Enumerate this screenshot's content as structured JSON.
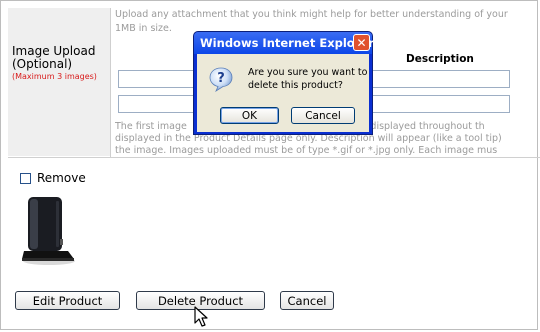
{
  "form": {
    "help_top_line1": "Upload any attachment that you think might help for better understanding of your",
    "help_top_line2": "1MB in size.",
    "label_line1": "Image Upload",
    "label_line2": "(Optional)",
    "label_note": "(Maximum 3 images)",
    "description_header": "Description",
    "help_bottom_line1": "The first image",
    "help_bottom_line1b": "hich is displayed throughout th",
    "help_bottom_line2": "displayed in the Product Details page only. Description will appear (like a tool tip)",
    "help_bottom_line3": "the image. Images uploaded must be of type *.gif or *.jpg only. Each image mus"
  },
  "remove": {
    "label": "Remove",
    "checked": false
  },
  "buttons": {
    "edit": "Edit Product",
    "delete": "Delete Product",
    "cancel": "Cancel"
  },
  "dialog": {
    "title": "Windows Internet Explorer",
    "close_glyph": "✕",
    "message_line1": "Are you sure you want to",
    "message_line2": "delete this product?",
    "ok": "OK",
    "cancel": "Cancel",
    "icon": "question-icon"
  },
  "colors": {
    "note_red": "#d81b1b",
    "dialog_blue": "#0a2fd2",
    "dialog_body": "#ece9d8",
    "close_red": "#e0522e"
  }
}
